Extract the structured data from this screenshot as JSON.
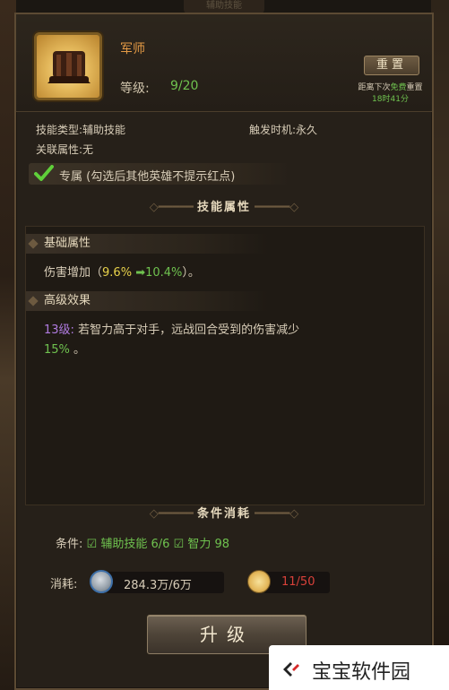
{
  "background": {
    "top_tab": "辅助技能"
  },
  "skill": {
    "name": "军师",
    "level_label": "等级:",
    "level_value": "9/20",
    "icon": "helmet-icon"
  },
  "reset": {
    "button_label": "重置",
    "hint_prefix": "距离下次",
    "hint_free": "免费",
    "hint_suffix": "重置",
    "timer": "18时41分"
  },
  "info": {
    "type_label": "技能类型:",
    "type_value": "辅助技能",
    "trigger_label": "触发时机:",
    "trigger_value": "永久",
    "attr_label": "关联属性:",
    "attr_value": "无"
  },
  "exclusive": {
    "checked": true,
    "label": "专属",
    "note": "(勾选后其他英雄不提示红点)"
  },
  "sections": {
    "attributes_title": "技能属性",
    "base_title": "基础属性",
    "base_text_prefix": "伤害增加（",
    "base_from": "9.6%",
    "base_to": "10.4%",
    "base_text_suffix": "）。",
    "advanced_title": "高级效果",
    "advanced_level": "13级:",
    "advanced_text": "若智力高于对手，远战回合受到的伤害减少",
    "advanced_value": "15%",
    "advanced_end": "。",
    "cost_title": "条件消耗"
  },
  "conditions": {
    "label": "条件:",
    "item1": "辅助技能 6/6",
    "item2": "智力 98"
  },
  "cost": {
    "label": "消耗:",
    "coin_value": "284.3万/6万",
    "token_value": "11/50",
    "coin_icon": "silver-coin-icon",
    "token_icon": "skill-book-icon"
  },
  "upgrade": {
    "label": "升级"
  },
  "watermark": {
    "text": "宝宝软件园"
  },
  "colors": {
    "accent_green": "#6fc24f",
    "accent_orange": "#e49a45",
    "accent_yellow": "#e8d24a",
    "accent_red": "#d8413a",
    "accent_purple": "#b07be0"
  }
}
